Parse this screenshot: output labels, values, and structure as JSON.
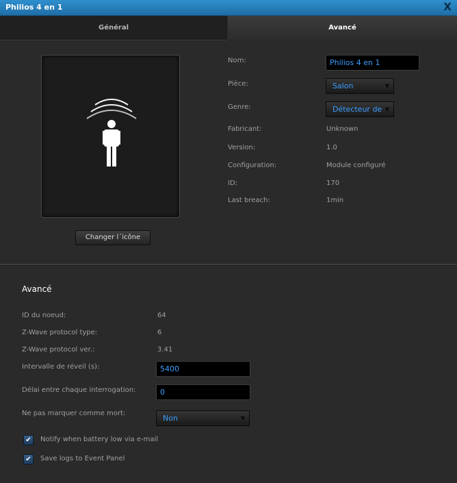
{
  "window": {
    "title": "Philios 4 en 1",
    "close_label": "X"
  },
  "tabs": [
    {
      "label": "Général",
      "active": false
    },
    {
      "label": "Avancé",
      "active": true
    }
  ],
  "device_icon": {
    "icon": "motion-sensor-person-icon"
  },
  "change_icon_label": "Changer l´icône",
  "general": {
    "name_label": "Nom:",
    "name_value": "Philios 4 en 1",
    "room_label": "Pièce:",
    "room_value": "Salon",
    "type_label": "Genre:",
    "type_value": "Détecteur de",
    "manufacturer_label": "Fabricant:",
    "manufacturer_value": "Unknown",
    "version_label": "Version:",
    "version_value": "1.0",
    "configuration_label": "Configuration:",
    "configuration_value": "Module configuré",
    "id_label": "ID:",
    "id_value": "170",
    "last_breach_label": "Last breach:",
    "last_breach_value": "1min"
  },
  "advanced": {
    "title": "Avancé",
    "node_id_label": "ID du noeud:",
    "node_id_value": "64",
    "protocol_type_label": "Z-Wave protocol type:",
    "protocol_type_value": "6",
    "protocol_ver_label": "Z-Wave protocol ver.:",
    "protocol_ver_value": "3.41",
    "wakeup_label": "Intervalle de réveil (s):",
    "wakeup_value": "5400",
    "poll_label": "Délai entre chaque interrogation:",
    "poll_value": "0",
    "dead_label": "Ne pas marquer comme mort:",
    "dead_value": "Non",
    "notify_label": "Notify when battery low via e-mail",
    "notify_checked": true,
    "logs_label": "Save logs to Event Panel",
    "logs_checked": true
  },
  "colors": {
    "titlebar": "#2f8fce",
    "background": "#2a2a2a",
    "input_text": "#3c9eff",
    "label_text": "#a0a0a0"
  }
}
